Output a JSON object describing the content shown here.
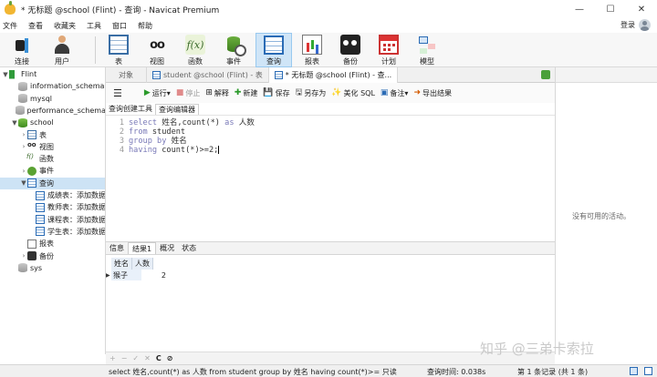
{
  "window": {
    "title": "* 无标题 @school (Flint) - 查询 - Navicat Premium",
    "controls": [
      "—",
      "☐",
      "✕"
    ]
  },
  "menu": {
    "items": [
      "文件",
      "查看",
      "收藏夹",
      "工具",
      "窗口",
      "帮助"
    ],
    "login": "登录"
  },
  "toolbar": {
    "connect": "连接",
    "user": "用户",
    "table": "表",
    "view": "视图",
    "function": "函数",
    "event": "事件",
    "query": "查询",
    "report": "报表",
    "backup": "备份",
    "schedule": "计划",
    "model": "模型"
  },
  "navigator": {
    "items": [
      {
        "label": "Flint",
        "depth": 0,
        "twisty": "▼",
        "icon": "connection-icon"
      },
      {
        "label": "information_schema",
        "depth": 1,
        "twisty": "",
        "icon": "database-icon"
      },
      {
        "label": "mysql",
        "depth": 1,
        "twisty": "",
        "icon": "database-icon"
      },
      {
        "label": "performance_schema",
        "depth": 1,
        "twisty": "",
        "icon": "database-icon"
      },
      {
        "label": "school",
        "depth": 1,
        "twisty": "▼",
        "icon": "database-open-icon"
      },
      {
        "label": "表",
        "depth": 2,
        "twisty": "›",
        "icon": "table-icon"
      },
      {
        "label": "视图",
        "depth": 2,
        "twisty": "›",
        "icon": "view-icon"
      },
      {
        "label": "函数",
        "depth": 2,
        "twisty": "",
        "icon": "function-icon"
      },
      {
        "label": "事件",
        "depth": 2,
        "twisty": "›",
        "icon": "event-icon"
      },
      {
        "label": "查询",
        "depth": 2,
        "twisty": "▼",
        "icon": "query-icon"
      },
      {
        "label": "成绩表：添加数据",
        "depth": 3,
        "twisty": "",
        "icon": "query-icon"
      },
      {
        "label": "教师表：添加数据",
        "depth": 3,
        "twisty": "",
        "icon": "query-icon"
      },
      {
        "label": "课程表：添加数据",
        "depth": 3,
        "twisty": "",
        "icon": "query-icon"
      },
      {
        "label": "学生表：添加数据",
        "depth": 3,
        "twisty": "",
        "icon": "query-icon"
      },
      {
        "label": "报表",
        "depth": 2,
        "twisty": "",
        "icon": "report-icon"
      },
      {
        "label": "备份",
        "depth": 2,
        "twisty": "›",
        "icon": "backup-icon"
      },
      {
        "label": "sys",
        "depth": 1,
        "twisty": "",
        "icon": "database-icon"
      }
    ],
    "selected": "查询"
  },
  "tabs": {
    "objects": "对象",
    "tab1": "student @school (Flint) - 表",
    "tab2": "* 无标题 @school (Flint) - 查..."
  },
  "editor_toolbar": {
    "run": "运行",
    "stop": "停止",
    "explain": "解释",
    "new": "新建",
    "save": "保存",
    "save_as": "另存为",
    "beautify": "美化 SQL",
    "comment": "备注",
    "export": "导出结果"
  },
  "editor_tabs": {
    "builder": "查询创建工具",
    "editor": "查询编辑器"
  },
  "code": {
    "line_numbers": [
      "1",
      "2",
      "3",
      "4"
    ],
    "l1_kw1": "select",
    "l1_rest": " 姓名,count(*) ",
    "l1_kw2": "as",
    "l1_tail": " 人数",
    "l2_kw": "from",
    "l2_rest": " student",
    "l3_kw": "group by",
    "l3_rest": " 姓名",
    "l4_kw": "having",
    "l4_rest": " count(*)>=2;"
  },
  "result_tabs": [
    "信息",
    "结果1",
    "概况",
    "状态"
  ],
  "result": {
    "columns": [
      "姓名",
      "人数"
    ],
    "rows": [
      [
        "猴子",
        "2"
      ]
    ]
  },
  "info_panel": {
    "message": "没有可用的活动。"
  },
  "grid_controls": [
    "+",
    "−",
    "✓",
    "✕",
    "C",
    "⊘"
  ],
  "watermark": "知乎 @三弟卡索拉",
  "status": {
    "sql": "select 姓名,count(*) as 人数 from student  group by 姓名 having count(*)>= 只读",
    "time": "查询时间: 0.038s",
    "records": "第 1 条记录 (共 1 条)"
  }
}
